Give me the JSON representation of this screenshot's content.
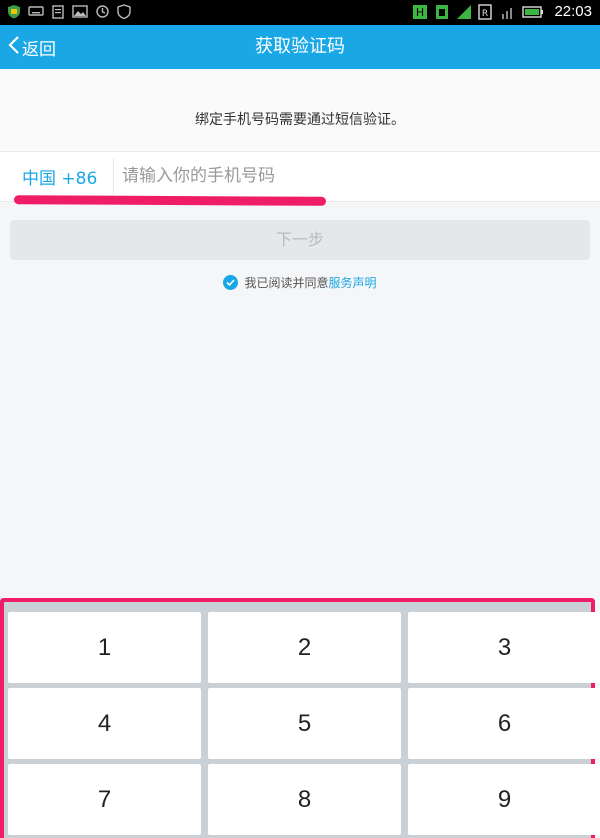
{
  "status_bar": {
    "time": "22:03"
  },
  "header": {
    "back_label": "返回",
    "title": "获取验证码"
  },
  "notice": "绑定手机号码需要通过短信验证。",
  "phone": {
    "country_code": "中国 +86",
    "placeholder": "请输入你的手机号码",
    "value": ""
  },
  "next_button": "下一步",
  "agreement": {
    "text": "我已阅读并同意",
    "link": "服务声明",
    "checked": true
  },
  "keypad": {
    "keys": [
      "1",
      "2",
      "3",
      "4",
      "5",
      "6",
      "7",
      "8",
      "9"
    ]
  },
  "colors": {
    "accent": "#1aa7e6",
    "highlight": "#ef1c66"
  }
}
